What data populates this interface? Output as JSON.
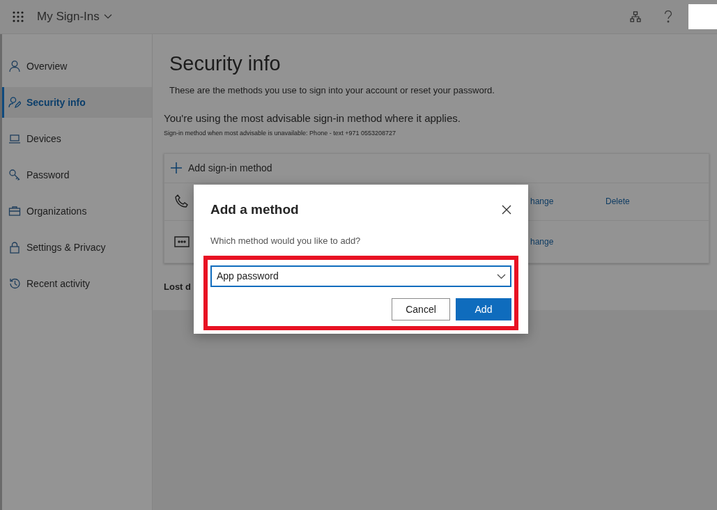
{
  "header": {
    "app_title": "My Sign-Ins"
  },
  "sidebar": {
    "items": [
      {
        "label": "Overview",
        "kind": "person",
        "selected": false
      },
      {
        "label": "Security info",
        "kind": "person-pen",
        "selected": true
      },
      {
        "label": "Devices",
        "kind": "laptop",
        "selected": false
      },
      {
        "label": "Password",
        "kind": "key",
        "selected": false
      },
      {
        "label": "Organizations",
        "kind": "briefcase",
        "selected": false
      },
      {
        "label": "Settings & Privacy",
        "kind": "lock",
        "selected": false
      },
      {
        "label": "Recent activity",
        "kind": "history",
        "selected": false
      }
    ]
  },
  "main": {
    "title": "Security info",
    "description": "These are the methods you use to sign into your account or reset your password.",
    "status": "You're using the most advisable sign-in method where it applies.",
    "fallback": "Sign-in method when most advisable is unavailable: Phone - text +971 0553208727",
    "add_method": "Add sign-in method",
    "methods": [
      {
        "kind": "phone",
        "actions": [
          "hange",
          "Delete"
        ]
      },
      {
        "kind": "app",
        "actions": [
          "hange"
        ]
      }
    ],
    "lost_device": "Lost d"
  },
  "dialog": {
    "title": "Add a method",
    "question": "Which method would you like to add?",
    "select_value": "App password",
    "buttons": [
      {
        "label": "Cancel",
        "kind": "secondary"
      },
      {
        "label": "Add",
        "kind": "primary"
      }
    ]
  }
}
